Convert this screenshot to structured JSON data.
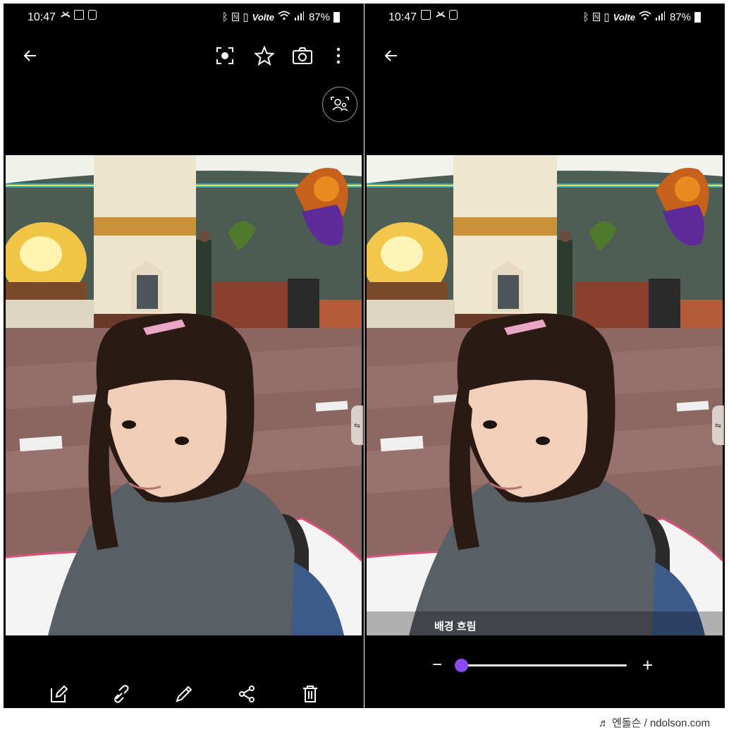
{
  "left_screen": {
    "status": {
      "time": "10:47",
      "battery": "87%",
      "network": "Volte"
    },
    "toolbar": {
      "icons": [
        "back-arrow",
        "live-focus",
        "star",
        "camera",
        "more-vertical"
      ]
    },
    "overlay_icon": "portrait-focus",
    "bottom_icons": [
      "edit",
      "link",
      "draw",
      "share",
      "delete"
    ]
  },
  "right_screen": {
    "status": {
      "time": "10:47",
      "battery": "87%",
      "network": "Volte"
    },
    "toolbar": {
      "icons": [
        "back-arrow"
      ]
    },
    "blur_label": "배경 흐림",
    "slider": {
      "minus": "−",
      "plus": "+",
      "value": 0
    }
  },
  "credit": "♬ 엔돌슨 / ndolson.com"
}
